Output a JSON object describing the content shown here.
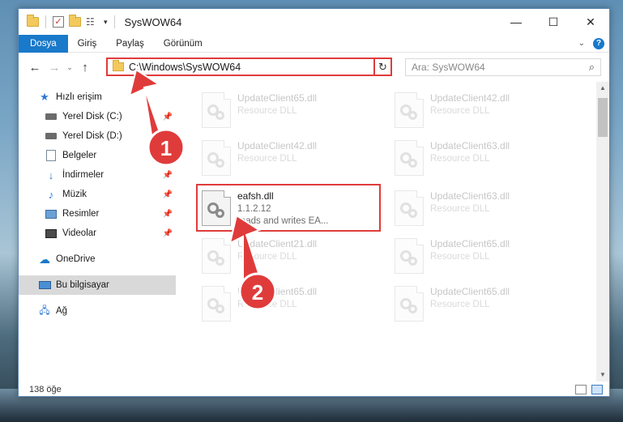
{
  "window": {
    "title": "SysWOW64",
    "controls": [
      "—",
      "☐",
      "✕"
    ]
  },
  "ribbon": {
    "tabs": [
      "Dosya",
      "Giriş",
      "Paylaş",
      "Görünüm"
    ],
    "active_tab": "Dosya"
  },
  "nav": {
    "address": "C:\\Windows\\SysWOW64",
    "search_placeholder": "Ara: SysWOW64"
  },
  "sidebar": {
    "items": [
      {
        "label": "Hızlı erişim",
        "icon": "star-icon"
      },
      {
        "label": "Yerel Disk (C:)",
        "icon": "drive-icon",
        "pinned": true
      },
      {
        "label": "Yerel Disk (D:)",
        "icon": "drive-icon",
        "pinned": false
      },
      {
        "label": "Belgeler",
        "icon": "documents-icon",
        "pinned": false
      },
      {
        "label": "İndirmeler",
        "icon": "download-icon",
        "pinned": true
      },
      {
        "label": "Müzik",
        "icon": "music-icon",
        "pinned": true
      },
      {
        "label": "Resimler",
        "icon": "pictures-icon",
        "pinned": true
      },
      {
        "label": "Videolar",
        "icon": "videos-icon",
        "pinned": true
      },
      {
        "label": "OneDrive",
        "icon": "onedrive-icon"
      },
      {
        "label": "Bu bilgisayar",
        "icon": "computer-icon",
        "selected": true
      },
      {
        "label": "Ağ",
        "icon": "network-icon"
      }
    ]
  },
  "files": [
    {
      "name": "UpdateClient65.dll",
      "sub": "Resource DLL",
      "faded": true
    },
    {
      "name": "UpdateClient42.dll",
      "sub": "Resource DLL",
      "faded": true
    },
    {
      "name": "UpdateClient42.dll",
      "sub": "Resource DLL",
      "faded": true
    },
    {
      "name": "UpdateClient63.dll",
      "sub": "Resource DLL",
      "faded": true
    },
    {
      "name": "eafsh.dll",
      "version": "1.1.2.12",
      "sub": "reads and writes EA...",
      "faded": false
    },
    {
      "name": "UpdateClient63.dll",
      "sub": "Resource DLL",
      "faded": true
    },
    {
      "name": "UpdateClient21.dll",
      "sub": "Resource DLL",
      "faded": true
    },
    {
      "name": "UpdateClient65.dll",
      "sub": "Resource DLL",
      "faded": true
    },
    {
      "name": "UpdateClient65.dll",
      "sub": "Resource DLL",
      "faded": true
    },
    {
      "name": "UpdateClient65.dll",
      "sub": "Resource DLL",
      "faded": true
    }
  ],
  "status": {
    "item_count": "138 öğe"
  },
  "annotations": {
    "step1": "1",
    "step2": "2",
    "color": "#e03b3b"
  }
}
